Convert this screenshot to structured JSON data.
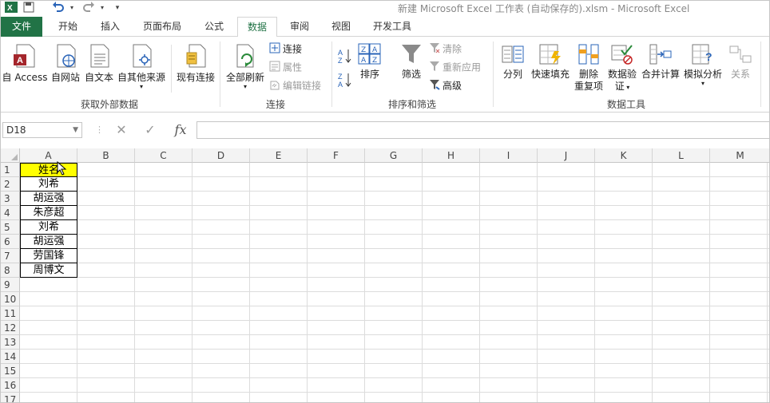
{
  "title_bar": {
    "title": "新建 Microsoft Excel 工作表 (自动保存的).xlsm - Microsoft Excel",
    "quick_access": [
      "save-icon",
      "undo-icon",
      "redo-icon",
      "customize-icon"
    ]
  },
  "tabs": [
    "文件",
    "开始",
    "插入",
    "页面布局",
    "公式",
    "数据",
    "审阅",
    "视图",
    "开发工具"
  ],
  "active_tab": "数据",
  "ribbon": {
    "get_external": {
      "label": "获取外部数据",
      "buttons": [
        "自 Access",
        "自网站",
        "自文本",
        "自其他来源",
        "现有连接"
      ]
    },
    "connections": {
      "label": "连接",
      "refresh_all": "全部刷新",
      "small": [
        "连接",
        "属性",
        "编辑链接"
      ]
    },
    "sort_filter": {
      "label": "排序和筛选",
      "sort": "排序",
      "filter": "筛选",
      "small": [
        "清除",
        "重新应用",
        "高级"
      ]
    },
    "data_tools": {
      "label": "数据工具",
      "split": "分列",
      "flash_fill": "快速填充",
      "remove_dup_1": "删除",
      "remove_dup_2": "重复项",
      "validation_1": "数据验",
      "validation_2": "证",
      "consolidate": "合并计算",
      "what_if": "模拟分析",
      "relationships": "关系"
    }
  },
  "formula_bar": {
    "name_box": "D18",
    "fx": "fx",
    "value": ""
  },
  "grid": {
    "columns": [
      "A",
      "B",
      "C",
      "D",
      "E",
      "F",
      "G",
      "H",
      "I",
      "J",
      "K",
      "L",
      "M"
    ],
    "rows": [
      "1",
      "2",
      "3",
      "4",
      "5",
      "6",
      "7",
      "8",
      "9",
      "10",
      "11",
      "12",
      "13",
      "14",
      "15",
      "16",
      "17"
    ],
    "column_a": [
      "姓名",
      "刘希",
      "胡运强",
      "朱彦超",
      "刘希",
      "胡运强",
      "劳国锋",
      "周博文"
    ],
    "header_fill": "#ffff00"
  },
  "colors": {
    "file_tab": "#217346",
    "active_tab_text": "#217346"
  }
}
